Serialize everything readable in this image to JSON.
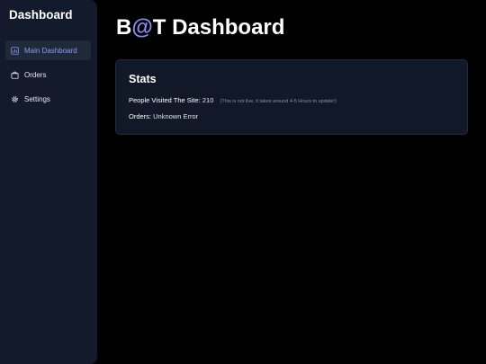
{
  "sidebar": {
    "title": "Dashboard",
    "items": [
      {
        "label": "Main Dashboard",
        "icon": "bar-chart-icon",
        "active": true
      },
      {
        "label": "Orders",
        "icon": "shopping-bag-icon",
        "active": false
      },
      {
        "label": "Settings",
        "icon": "gear-icon",
        "active": false
      }
    ]
  },
  "header": {
    "title_prefix": "B",
    "title_at": "@",
    "title_suffix": "T Dashboard"
  },
  "stats": {
    "title": "Stats",
    "visited_label": "People Visited The Site:",
    "visited_value": "210",
    "visited_note": "(This is not live, it takes around 4-5 Hours to update!)",
    "orders_label": "Orders:",
    "orders_value": "Unknown Error"
  },
  "colors": {
    "background": "#000000",
    "sidebar": "#121a2b",
    "card": "#111827",
    "accent": "#8b8cf0",
    "active_text": "#8b9cf7"
  }
}
